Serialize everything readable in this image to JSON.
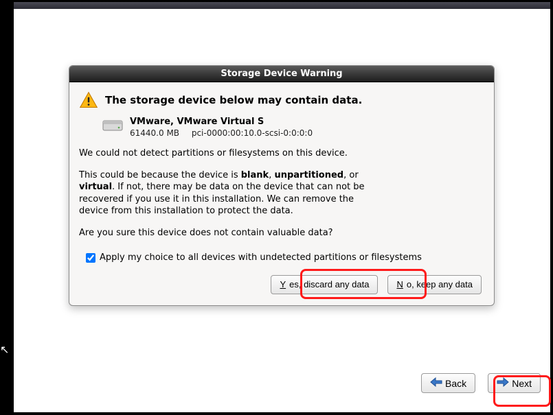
{
  "dialog": {
    "title": "Storage Device Warning",
    "heading": "The storage device below may contain data.",
    "device": {
      "name": "VMware, VMware Virtual S",
      "size": "61440.0 MB",
      "path": "pci-0000:00:10.0-scsi-0:0:0:0"
    },
    "para1": "We could not detect partitions or filesystems on this device.",
    "para2_pre": "This could be because the device is ",
    "para2_b1": "blank",
    "para2_mid1": ", ",
    "para2_b2": "unpartitioned",
    "para2_mid2": ", or ",
    "para2_b3": "virtual",
    "para2_post": ". If not, there may be data on the device that can not be recovered if you use it in this installation. We can remove the device from this installation to protect the data.",
    "para3": "Are you sure this device does not contain valuable data?",
    "checkbox_label_pre": "A",
    "checkbox_label_rest": "pply my choice to all devices with undetected partitions or filesystems",
    "checkbox_checked": true,
    "btn_yes_pre": "Y",
    "btn_yes_rest": "es, discard any data",
    "btn_no_pre": "N",
    "btn_no_rest": "o, keep any data"
  },
  "footer": {
    "back_pre": "B",
    "back_rest": "ack",
    "next_pre": "N",
    "next_rest": "ext"
  }
}
